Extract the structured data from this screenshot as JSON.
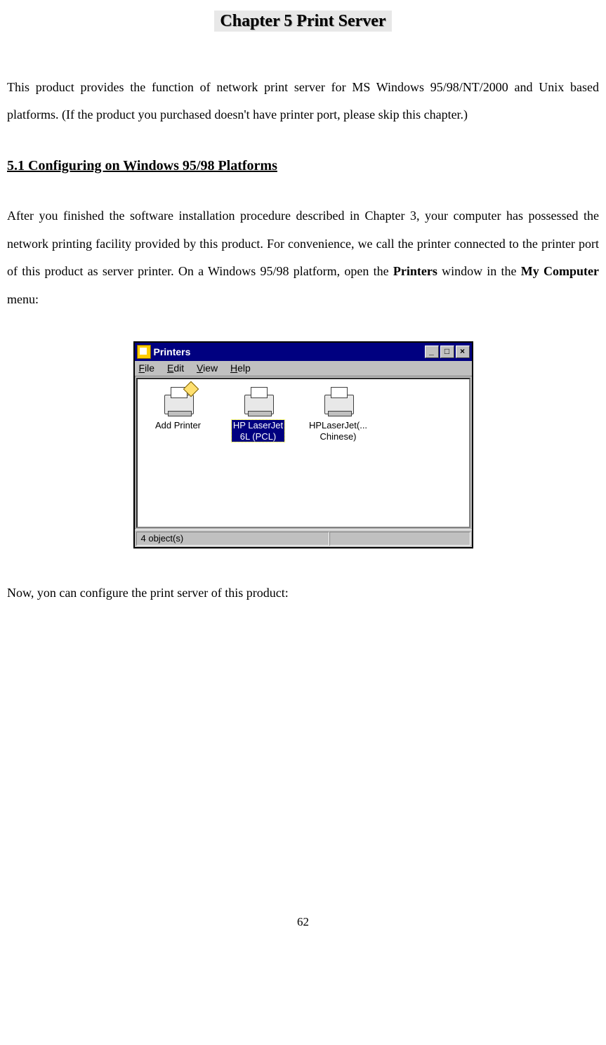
{
  "chapter_title": "Chapter 5    Print Server",
  "intro": "This product provides the function of network print server for MS Windows 95/98/NT/2000 and Unix based platforms. (If the product you purchased doesn't have printer port, please skip this chapter.)",
  "section_heading": "5.1 Configuring on Windows 95/98 Platforms",
  "body_part1": "After you finished the software installation procedure described in Chapter 3, your computer has possessed the network printing facility provided by this product. For convenience, we call the printer connected to the printer port of this product as server printer. On a Windows 95/98 platform, open the ",
  "printers_bold": "Printers",
  "body_mid": " window in the ",
  "mycomputer_bold": "My Computer",
  "body_end": " menu:",
  "window": {
    "title": "Printers",
    "menu": {
      "file": "File",
      "edit": "Edit",
      "view": "View",
      "help": "Help"
    },
    "icons": {
      "add_printer": "Add Printer",
      "hp6l_line1": "HP LaserJet",
      "hp6l_line2": "6L (PCL)",
      "hpchinese_line1": "HPLaserJet(...",
      "hpchinese_line2": "Chinese)"
    },
    "status": "4 object(s)",
    "controls": {
      "min": "_",
      "max": "□",
      "close": "×"
    }
  },
  "after_text": "Now, yon can configure the print server of this product:",
  "page_number": "62"
}
